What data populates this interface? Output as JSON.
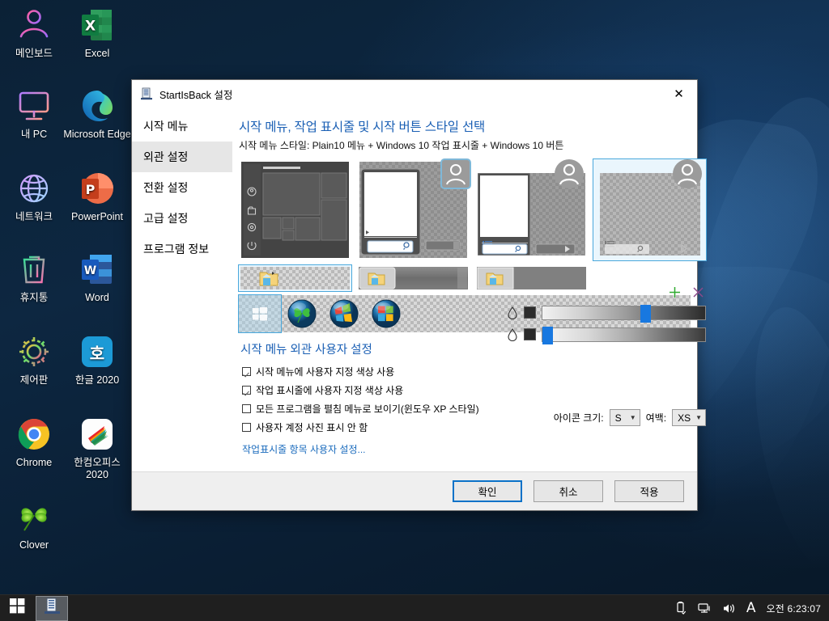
{
  "desktop": {
    "icons": [
      {
        "label": "메인보드",
        "icon": "mainboard-person-icon"
      },
      {
        "label": "Excel",
        "icon": "excel-icon"
      },
      {
        "label": "내 PC",
        "icon": "this-pc-monitor-icon"
      },
      {
        "label": "Microsoft Edge",
        "icon": "edge-icon"
      },
      {
        "label": "네트워크",
        "icon": "network-globe-icon"
      },
      {
        "label": "PowerPoint",
        "icon": "powerpoint-icon"
      },
      {
        "label": "휴지통",
        "icon": "recycle-bin-icon"
      },
      {
        "label": "Word",
        "icon": "word-icon"
      },
      {
        "label": "제어판",
        "icon": "control-panel-gear-icon"
      },
      {
        "label": "한글 2020",
        "icon": "hangul-icon"
      },
      {
        "label": "Chrome",
        "icon": "chrome-icon"
      },
      {
        "label": "한컴오피스 2020",
        "icon": "hancom-office-icon"
      },
      {
        "label": "Clover",
        "icon": "clover-icon"
      }
    ]
  },
  "taskbar": {
    "start_icon": "windows-start-icon",
    "items": [
      {
        "name": "startisback-taskbar-item",
        "icon": "startisback-icon"
      }
    ],
    "tray": [
      {
        "name": "usb-eject-icon"
      },
      {
        "name": "network-icon"
      },
      {
        "name": "volume-icon"
      },
      {
        "name": "ime-korean-icon",
        "label": "A"
      }
    ],
    "clock": "오전 6:23:07"
  },
  "dialog": {
    "title": "StartIsBack 설정",
    "title_icon": "startisback-icon",
    "close_label": "✕",
    "sidebar": {
      "items": [
        {
          "label": "시작 메뉴",
          "selected": false
        },
        {
          "label": "외관 설정",
          "selected": true
        },
        {
          "label": "전환 설정",
          "selected": false
        },
        {
          "label": "고급 설정",
          "selected": false
        },
        {
          "label": "프로그램 정보",
          "selected": false
        }
      ]
    },
    "content": {
      "heading": "시작 메뉴, 작업 표시줄 및 시작 버튼 스타일 선택",
      "style_summary": "시작 메뉴 스타일: Plain10 메뉴 + Windows 10 작업 표시줄 + Windows 10 버튼",
      "menu_styles": [
        {
          "name": "menu-style-windows10-tiles",
          "selected": false
        },
        {
          "name": "menu-style-plain7",
          "selected": false
        },
        {
          "name": "menu-style-plain8",
          "selected": false
        },
        {
          "name": "menu-style-plain10",
          "selected": true
        }
      ],
      "taskbar_styles": [
        {
          "name": "taskbar-style-windows10",
          "selected": true
        },
        {
          "name": "taskbar-style-windows7",
          "selected": false
        },
        {
          "name": "taskbar-style-windows8",
          "selected": false
        }
      ],
      "orb_styles": [
        {
          "name": "orb-windows10",
          "selected": true
        },
        {
          "name": "orb-clover",
          "selected": false
        },
        {
          "name": "orb-windows7",
          "selected": false
        },
        {
          "name": "orb-windows8",
          "selected": false
        }
      ],
      "appearance_heading": "시작 메뉴 외관 사용자 설정",
      "checkboxes": [
        {
          "label": "시작 메뉴에 사용자 지정 색상 사용",
          "checked": true
        },
        {
          "label": "작업 표시줄에 사용자 지정 색상 사용",
          "checked": true
        },
        {
          "label": "모든 프로그램을 펼침 메뉴로 보이기(윈도우 XP 스타일)",
          "checked": false
        },
        {
          "label": "사용자 계정 사진 표시 안 함",
          "checked": false
        }
      ],
      "taskbar_link": "작업표시줄 항목 사용자 설정...",
      "add_icon": "plus-icon",
      "remove_icon": "close-x-icon",
      "sliders": [
        {
          "name": "start-menu-color-slider",
          "icon": "water-drop-icon",
          "swatch": "#2b2b2b",
          "position_percent": 62
        },
        {
          "name": "taskbar-color-slider",
          "icon": "water-drop-icon",
          "swatch": "#2b2b2b",
          "position_percent": 2
        }
      ],
      "icon_size_label": "아이콘 크기:",
      "icon_size_value": "S",
      "padding_label": "여백:",
      "padding_value": "XS"
    },
    "footer": {
      "ok": "확인",
      "cancel": "취소",
      "apply": "적용"
    }
  },
  "colors": {
    "accent": "#1a5fb4",
    "link": "#1a6bbd",
    "selection": "#4aa8dc",
    "slider_knob": "#1878e0"
  }
}
